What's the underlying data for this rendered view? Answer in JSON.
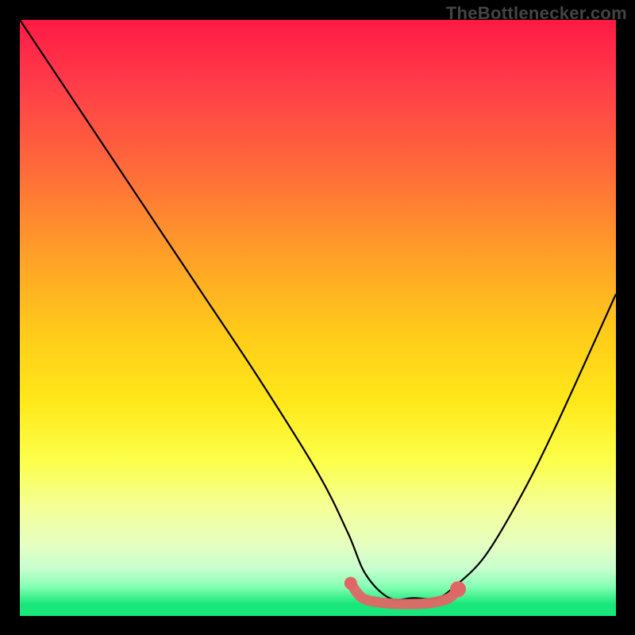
{
  "attribution": "TheBottlenecker.com",
  "chart_data": {
    "type": "line",
    "title": "",
    "xlabel": "",
    "ylabel": "",
    "xlim": [
      0,
      100
    ],
    "ylim": [
      0,
      100
    ],
    "series": [
      {
        "name": "bottleneck-curve",
        "x": [
          0,
          4,
          10,
          20,
          30,
          40,
          50,
          55,
          58,
          62,
          66,
          70,
          73,
          78,
          84,
          90,
          100
        ],
        "y": [
          100,
          94,
          85,
          70,
          55,
          40,
          24,
          14,
          7,
          3,
          3,
          3,
          5,
          10,
          20,
          32,
          54
        ]
      }
    ],
    "highlight": {
      "name": "optimal-range",
      "color": "#e06666",
      "points": [
        {
          "x": 55.5,
          "y": 5.5
        },
        {
          "x": 57.5,
          "y": 3.0
        },
        {
          "x": 61.0,
          "y": 2.2
        },
        {
          "x": 65.0,
          "y": 2.0
        },
        {
          "x": 69.0,
          "y": 2.2
        },
        {
          "x": 72.0,
          "y": 3.0
        },
        {
          "x": 73.5,
          "y": 4.5
        }
      ]
    },
    "gradient_stops": [
      {
        "pos": 0,
        "color": "#ff1a44"
      },
      {
        "pos": 25,
        "color": "#ff6a3a"
      },
      {
        "pos": 52,
        "color": "#ffc91a"
      },
      {
        "pos": 74,
        "color": "#fcff4a"
      },
      {
        "pos": 92,
        "color": "#c8ffcf"
      },
      {
        "pos": 100,
        "color": "#18e87a"
      }
    ]
  }
}
